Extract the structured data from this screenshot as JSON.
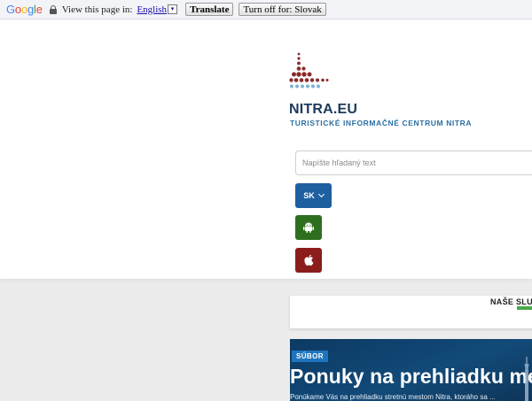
{
  "translate_bar": {
    "logo": "Google",
    "prompt": "View this page in:",
    "language": "English",
    "translate_label": "Translate",
    "turn_off_label": "Turn off for: Slovak"
  },
  "header": {
    "title": "NITRA.EU",
    "subtitle": "TURISTICKÉ INFORMAČNÉ CENTRUM NITRA"
  },
  "search": {
    "placeholder": "Napíšte hľadaný text"
  },
  "language_selector": {
    "value": "SK"
  },
  "app_links": [
    {
      "name": "android",
      "icon": "android-icon",
      "color": "#2e6f1f"
    },
    {
      "name": "apple",
      "icon": "apple-icon",
      "color": "#8b1d1d"
    }
  ],
  "services": {
    "title": "NAŠE SLUŽ",
    "accent_color": "#4aa84a"
  },
  "banner": {
    "tag": "SÚBOR",
    "title": "Ponuky na prehliadku me",
    "text": "Ponúkame Vás na prehliadku stretnú mestom Nitra, ktoráho sa ...",
    "color": "#0c3a63"
  },
  "colors": {
    "brand_navy": "#1b3a5c",
    "brand_blue": "#2a6fa3",
    "button_blue": "#1e5fa0",
    "logo_red": "#8b2a2a",
    "logo_blue": "#7fb3d5"
  }
}
